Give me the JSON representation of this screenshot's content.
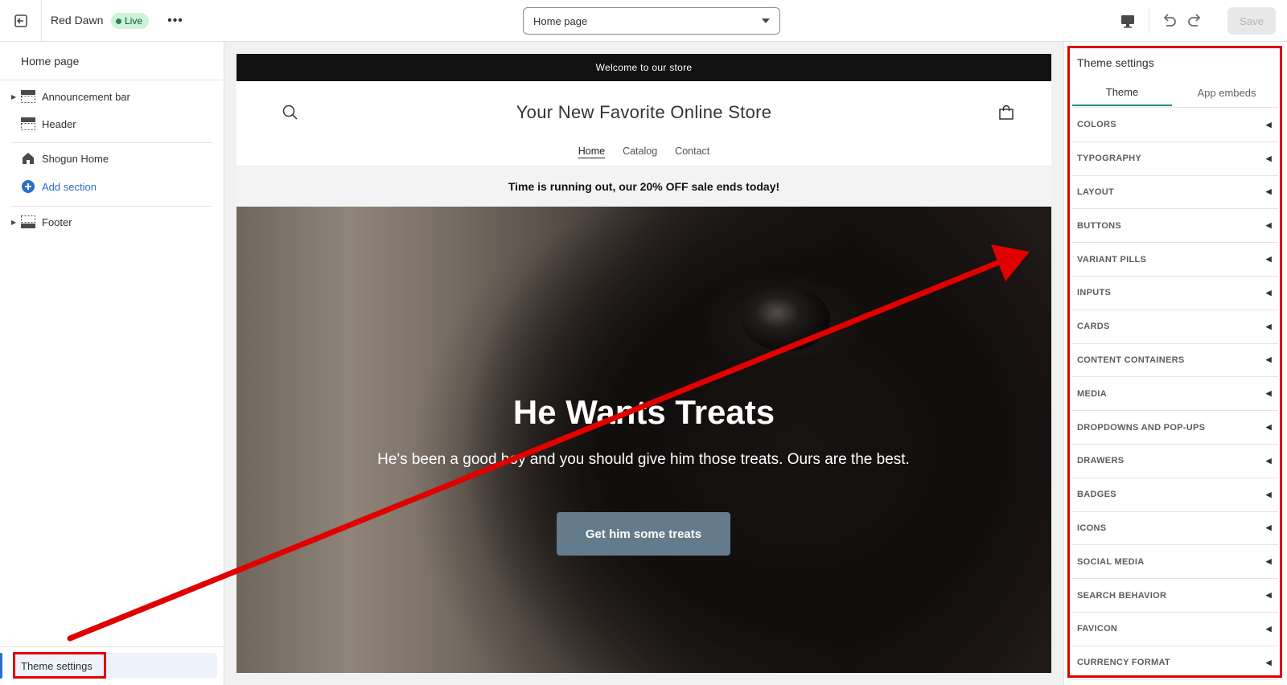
{
  "topbar": {
    "store_name": "Red Dawn",
    "status_badge": "Live",
    "page_select_value": "Home page",
    "save_label": "Save"
  },
  "sidebar": {
    "title": "Home page",
    "items": [
      {
        "label": "Announcement bar",
        "icon": "announcement-bar-icon"
      },
      {
        "label": "Header",
        "icon": "header-section-icon"
      },
      {
        "label": "Shogun Home",
        "icon": "home-icon"
      },
      {
        "label": "Add section",
        "icon": "plus-circle-icon"
      },
      {
        "label": "Footer",
        "icon": "footer-section-icon"
      }
    ],
    "theme_settings_label": "Theme settings"
  },
  "preview": {
    "announcement": "Welcome to our store",
    "store_title": "Your New Favorite Online Store",
    "nav": [
      "Home",
      "Catalog",
      "Contact"
    ],
    "sale_text": "Time is running out, our 20% OFF sale ends today!",
    "hero_heading": "He Wants Treats",
    "hero_text": "He's been a good boy and you should give him those treats. Ours are the best.",
    "hero_button": "Get him some treats"
  },
  "theme_panel": {
    "title": "Theme settings",
    "tabs": [
      "Theme",
      "App embeds"
    ],
    "sections": [
      "COLORS",
      "TYPOGRAPHY",
      "LAYOUT",
      "BUTTONS",
      "VARIANT PILLS",
      "INPUTS",
      "CARDS",
      "CONTENT CONTAINERS",
      "MEDIA",
      "DROPDOWNS AND POP-UPS",
      "DRAWERS",
      "BADGES",
      "ICONS",
      "SOCIAL MEDIA",
      "SEARCH BEHAVIOR",
      "FAVICON",
      "CURRENCY FORMAT"
    ]
  },
  "colors": {
    "annotation": "#e00000",
    "accent": "#2c6ecb",
    "live_badge_bg": "#cdf4d9",
    "hero_button_bg": "#647b8b"
  }
}
